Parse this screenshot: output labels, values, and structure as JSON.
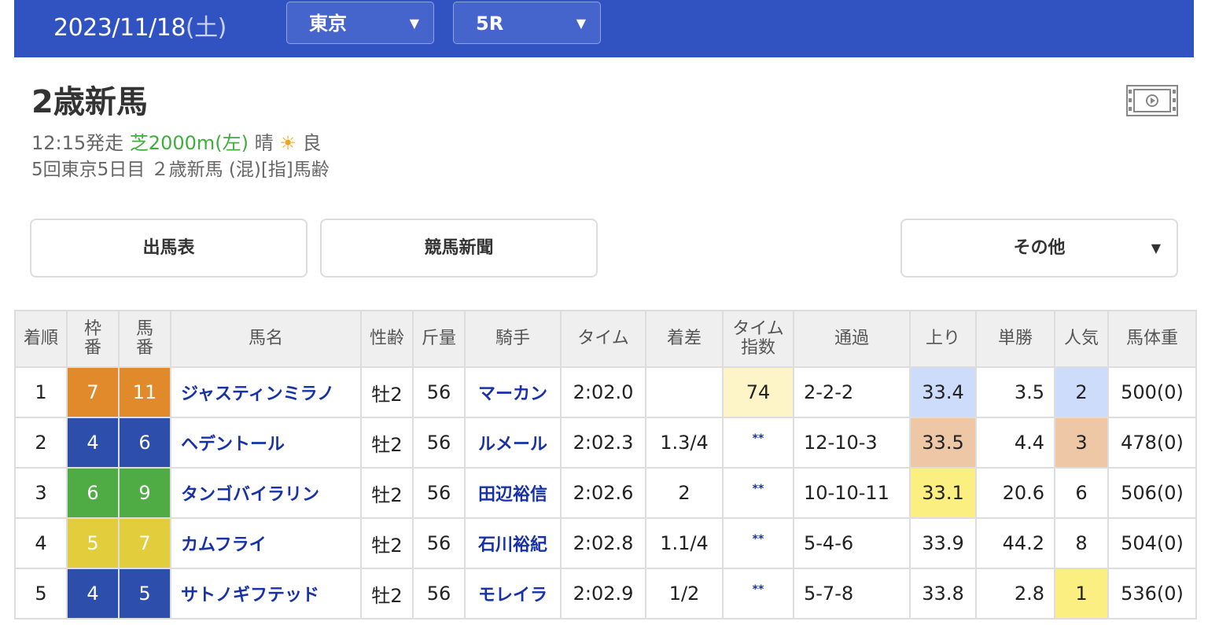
{
  "header": {
    "date": "2023/11/18",
    "day_of_week": "(土)",
    "venue_select": "東京",
    "race_select": "5R"
  },
  "race": {
    "title": "2歳新馬",
    "start_time": "12:15発走",
    "course": "芝2000m(左)",
    "weather": "晴",
    "weather_icon": "sun-icon",
    "track_condition": "良",
    "details": "5回東京5日目 ２歳新馬 (混)[指]馬齢"
  },
  "buttons": {
    "entries": "出馬表",
    "newspaper": "競馬新聞",
    "other": "その他"
  },
  "colors": {
    "header_bg": "#3153c2",
    "frame_7": "#e08a2c",
    "frame_4": "#2d4fab",
    "frame_6": "#4fac44",
    "frame_5": "#e2cd3c",
    "highlight_blue": "#cddcfb",
    "highlight_orange": "#eec8a6",
    "highlight_yellow": "#fbef82",
    "highlight_cream": "#fdf4c8"
  },
  "table": {
    "headers": [
      "着順",
      "枠番",
      "馬番",
      "馬名",
      "性齢",
      "斤量",
      "騎手",
      "タイム",
      "着差",
      "タイム指数",
      "通過",
      "上り",
      "単勝",
      "人気",
      "馬体重"
    ],
    "header_lines": {
      "frame": [
        "枠",
        "番"
      ],
      "horse_no": [
        "馬",
        "番"
      ],
      "time_index": [
        "タイム",
        "指数"
      ]
    },
    "rows": [
      {
        "rank": "1",
        "frame": "7",
        "horse_no": "11",
        "name": "ジャスティンミラノ",
        "sex_age": "牡2",
        "weight": "56",
        "jockey": "マーカン",
        "time": "2:02.0",
        "margin": "",
        "time_index": "74",
        "passing": "2-2-2",
        "last3f": "33.4",
        "odds": "3.5",
        "popularity": "2",
        "body_weight": "500(0)"
      },
      {
        "rank": "2",
        "frame": "4",
        "horse_no": "6",
        "name": "ヘデントール",
        "sex_age": "牡2",
        "weight": "56",
        "jockey": "ルメール",
        "time": "2:02.3",
        "margin": "1.3/4",
        "time_index": "**",
        "passing": "12-10-3",
        "last3f": "33.5",
        "odds": "4.4",
        "popularity": "3",
        "body_weight": "478(0)"
      },
      {
        "rank": "3",
        "frame": "6",
        "horse_no": "9",
        "name": "タンゴバイラリン",
        "sex_age": "牡2",
        "weight": "56",
        "jockey": "田辺裕信",
        "time": "2:02.6",
        "margin": "2",
        "time_index": "**",
        "passing": "10-10-11",
        "last3f": "33.1",
        "odds": "20.6",
        "popularity": "6",
        "body_weight": "506(0)"
      },
      {
        "rank": "4",
        "frame": "5",
        "horse_no": "7",
        "name": "カムフライ",
        "sex_age": "牡2",
        "weight": "56",
        "jockey": "石川裕紀",
        "time": "2:02.8",
        "margin": "1.1/4",
        "time_index": "**",
        "passing": "5-4-6",
        "last3f": "33.9",
        "odds": "44.2",
        "popularity": "8",
        "body_weight": "504(0)"
      },
      {
        "rank": "5",
        "frame": "4",
        "horse_no": "5",
        "name": "サトノギフテッド",
        "sex_age": "牡2",
        "weight": "56",
        "jockey": "モレイラ",
        "time": "2:02.9",
        "margin": "1/2",
        "time_index": "**",
        "passing": "5-7-8",
        "last3f": "33.8",
        "odds": "2.8",
        "popularity": "1",
        "body_weight": "536(0)"
      }
    ]
  }
}
